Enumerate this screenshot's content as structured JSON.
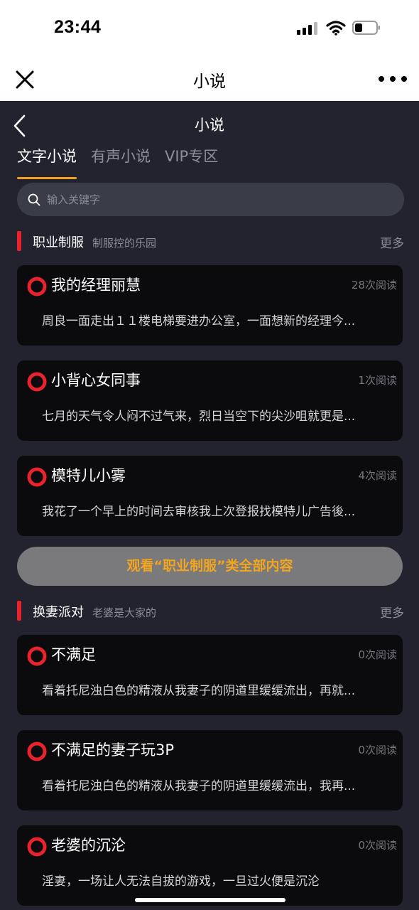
{
  "status_bar": {
    "time": "23:44"
  },
  "mini_program": {
    "title": "小说"
  },
  "page": {
    "title": "小说"
  },
  "tabs": [
    {
      "label": "文字小说",
      "active": true
    },
    {
      "label": "有声小说",
      "active": false
    },
    {
      "label": "VIP专区",
      "active": false
    }
  ],
  "search": {
    "placeholder": "输入关键字"
  },
  "colors": {
    "accent": "#f0a020",
    "section_marker": "#e8232b",
    "card_icon": "#e8232b",
    "background": "#22232e",
    "card": "#0b0b0d"
  },
  "sections": [
    {
      "title": "职业制服",
      "subtitle": "制服控的乐园",
      "more_label": "更多",
      "view_all_label": "观看“职业制服”类全部内容",
      "items": [
        {
          "title": "我的经理丽慧",
          "reads": "28次阅读",
          "excerpt": "周良一面走出１１楼电梯要进办公室，一面想新的经理今..."
        },
        {
          "title": "小背心女同事",
          "reads": "1次阅读",
          "excerpt": "七月的天气令人闷不过气来，烈日当空下的尖沙咀就更是..."
        },
        {
          "title": "模特儿小雾",
          "reads": "4次阅读",
          "excerpt": "我花了一个早上的时间去审核我上次登报找模特儿广告後..."
        }
      ]
    },
    {
      "title": "换妻派对",
      "subtitle": "老婆是大家的",
      "more_label": "更多",
      "items": [
        {
          "title": "不满足",
          "reads": "0次阅读",
          "excerpt": "看着托尼浊白色的精液从我妻子的阴道里缓缓流出，再就..."
        },
        {
          "title": "不满足的妻子玩3P",
          "reads": "0次阅读",
          "excerpt": "看着托尼浊白色的精液从我妻子的阴道里缓缓流出，我再..."
        },
        {
          "title": "老婆的沉沦",
          "reads": "0次阅读",
          "excerpt": "淫妻，一场让人无法自拔的游戏，一旦过火便是沉沦"
        }
      ]
    }
  ]
}
